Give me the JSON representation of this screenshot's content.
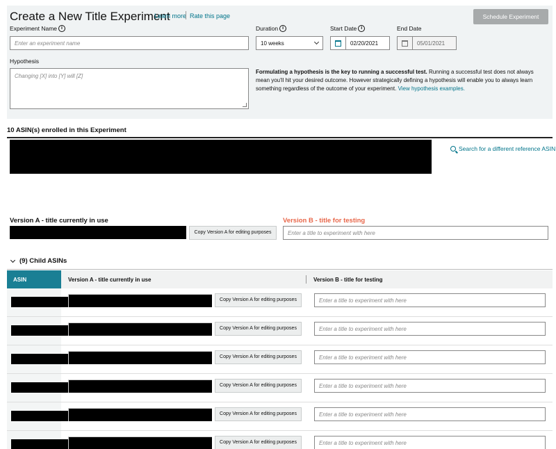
{
  "header": {
    "title": "Create a New Title Experiment",
    "learn_more": "Learn more",
    "rate_page": "Rate this page",
    "schedule_button": "Schedule Experiment"
  },
  "form": {
    "experiment_name_label": "Experiment Name",
    "experiment_name_placeholder": "Enter an experiment name",
    "duration_label": "Duration",
    "duration_value": "10 weeks",
    "start_date_label": "Start Date",
    "start_date_value": "02/20/2021",
    "end_date_label": "End Date",
    "end_date_value": "05/01/2021",
    "hypothesis_label": "Hypothesis",
    "hypothesis_placeholder": "Changing [X] into [Y] will [Z]",
    "hypothesis_help_bold": "Formulating a hypothesis is the key to running a successful test.",
    "hypothesis_help_text": " Running a successful test does not always mean you'll hit your desired outcome. However strategically defining a hypothesis will enable you to always learn something regardless of the outcome of your experiment. ",
    "hypothesis_help_link": "View hypothesis examples."
  },
  "enrolled": {
    "title": "10 ASIN(s) enrolled in this Experiment",
    "search_link": "Search for a different reference ASIN"
  },
  "parent": {
    "version_a_title": "Version A - title currently in use",
    "version_b_title": "Version B - title for testing",
    "copy_button": "Copy Version A for editing purposes",
    "version_b_placeholder": "Enter a title to experiment with here"
  },
  "child": {
    "toggle_label": "(9) Child ASINs",
    "columns": [
      "ASIN",
      "Version A - title currently in use",
      "Version B - title for testing"
    ],
    "rows": [
      {
        "copy_button": "Copy Version A for editing purposes",
        "placeholder": "Enter a title to experiment with here"
      },
      {
        "copy_button": "Copy Version A for editing purposes",
        "placeholder": "Enter a title to experiment with here"
      },
      {
        "copy_button": "Copy Version A for editing purposes",
        "placeholder": "Enter a title to experiment with here"
      },
      {
        "copy_button": "Copy Version A for editing purposes",
        "placeholder": "Enter a title to experiment with here"
      },
      {
        "copy_button": "Copy Version A for editing purposes",
        "placeholder": "Enter a title to experiment with here"
      },
      {
        "copy_button": "Copy Version A for editing purposes",
        "placeholder": "Enter a title to experiment with here"
      }
    ]
  },
  "colors": {
    "accent_teal": "#1a7f94",
    "link": "#00748a",
    "version_b": "#e8674a",
    "panel_bg": "#f0f3f4",
    "disabled_button": "#a7aaab"
  },
  "icons": [
    "info-icon",
    "chevron-down-icon",
    "calendar-icon",
    "search-icon"
  ]
}
